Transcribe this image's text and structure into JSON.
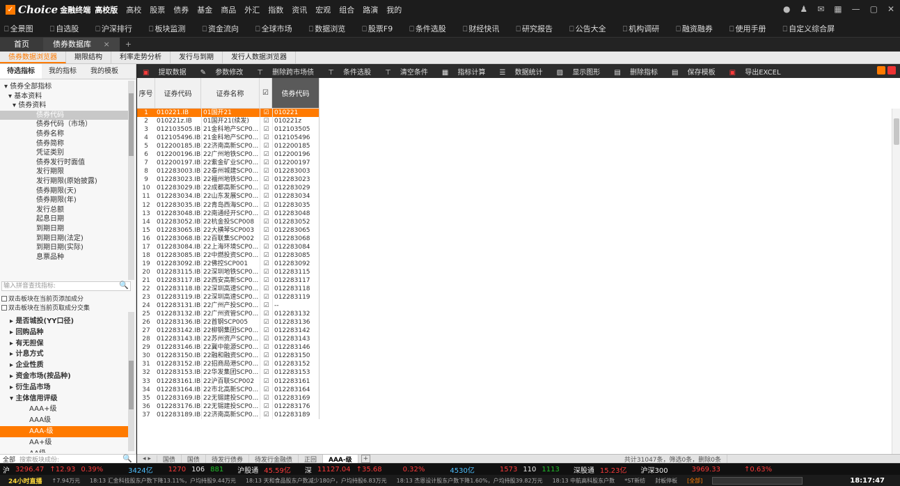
{
  "titlebar": {
    "brand": "Choice",
    "brand_sub": "金融终端",
    "edition": "高校版",
    "menu": [
      "高校",
      "股票",
      "债券",
      "基金",
      "商品",
      "外汇",
      "指数",
      "资讯",
      "宏观",
      "组合",
      "路演",
      "我的"
    ]
  },
  "toolbar": [
    "全景图",
    "自选股",
    "沪深排行",
    "板块监测",
    "资金流向",
    "全球市场",
    "数据浏览",
    "股票F9",
    "条件选股",
    "财经快讯",
    "研究报告",
    "公告大全",
    "机构调研",
    "融资融券",
    "使用手册",
    "自定义综合屏"
  ],
  "tabs": {
    "home": "首页",
    "current": "债券数据库",
    "add": "+"
  },
  "subtabs": [
    "债券数据浏览器",
    "期限结构",
    "利率走势分析",
    "发行与到期",
    "发行人数据浏览器"
  ],
  "left": {
    "tabs": [
      "待选指标",
      "我的指标",
      "我的模板"
    ],
    "tree": [
      "▾ 债券全部指标",
      "  ▾ 基本资料",
      "    ▾ 债券资料",
      "债券代码",
      "债券代码（市场）",
      "债券名称",
      "债券简称",
      "凭证类别",
      "债券发行时面值",
      "发行期限",
      "发行期限(原始披露)",
      "债券期限(天)",
      "债券期限(年)",
      "发行总额",
      "起息日期",
      "到期日期",
      "到期日期(法定)",
      "到期日期(实际)",
      "息票品种"
    ],
    "search_placeholder": "输入拼音查找指标:",
    "check1": "双击板块在当前页添加成分",
    "check2": "双击板块在当前页取成分交集",
    "tree2": [
      "▸ 是否城投(YY口径)",
      "▸ 回购品种",
      "▸ 有无担保",
      "▸ 计息方式",
      "▸ 企业性质",
      "▸ 资金市场(按品种)",
      "▸ 衍生品市场",
      "▾ 主体信用评级",
      "AAA+级",
      "AAA级",
      "AAA-级",
      "AA+级",
      "AA级"
    ],
    "bottom_label": "全部",
    "bottom_search": "搜索板块成份:"
  },
  "actions": [
    "提取数据",
    "参数修改",
    "删除跨市场债",
    "条件选股",
    "清空条件",
    "指标计算",
    "数据统计",
    "显示图形",
    "删除指标",
    "保存模板",
    "导出EXCEL"
  ],
  "grid": {
    "headers": [
      "序号",
      "证券代码",
      "证券名称",
      "☑",
      "债券代码"
    ],
    "rows": [
      [
        "1",
        "010221.IB",
        "01国开21",
        "☑",
        "010221"
      ],
      [
        "2",
        "010221z.IB",
        "01国开21(续发)",
        "☑",
        "010221z"
      ],
      [
        "3",
        "012103505.IB",
        "21金科地产SCP0...",
        "☑",
        "012103505"
      ],
      [
        "4",
        "012105496.IB",
        "21金科地产SCP0...",
        "☑",
        "012105496"
      ],
      [
        "5",
        "012200185.IB",
        "22济南高新SCP0...",
        "☑",
        "012200185"
      ],
      [
        "6",
        "012200196.IB",
        "22广州地铁SCP0...",
        "☑",
        "012200196"
      ],
      [
        "7",
        "012200197.IB",
        "22紫金矿业SCP0...",
        "☑",
        "012200197"
      ],
      [
        "8",
        "012283003.IB",
        "22泰州城建SCP0...",
        "☑",
        "012283003"
      ],
      [
        "9",
        "012283023.IB",
        "22福州地铁SCP0...",
        "☑",
        "012283023"
      ],
      [
        "10",
        "012283029.IB",
        "22成都高新SCP0...",
        "☑",
        "012283029"
      ],
      [
        "11",
        "012283034.IB",
        "22山东发展SCP0...",
        "☑",
        "012283034"
      ],
      [
        "12",
        "012283035.IB",
        "22青岛西海SCP0...",
        "☑",
        "012283035"
      ],
      [
        "13",
        "012283048.IB",
        "22南通经开SCP0...",
        "☑",
        "012283048"
      ],
      [
        "14",
        "012283052.IB",
        "22杭金投SCP008",
        "☑",
        "012283052"
      ],
      [
        "15",
        "012283065.IB",
        "22大横琴SCP003",
        "☑",
        "012283065"
      ],
      [
        "16",
        "012283068.IB",
        "22百联集SCP002",
        "☑",
        "012283068"
      ],
      [
        "17",
        "012283084.IB",
        "22上海环境SCP0...",
        "☑",
        "012283084"
      ],
      [
        "18",
        "012283085.IB",
        "22中燃投资SCP0...",
        "☑",
        "012283085"
      ],
      [
        "19",
        "012283092.IB",
        "22佛控SCP001",
        "☑",
        "012283092"
      ],
      [
        "20",
        "012283115.IB",
        "22深圳地铁SCP0...",
        "☑",
        "012283115"
      ],
      [
        "21",
        "012283117.IB",
        "22西安高新SCP0...",
        "☑",
        "012283117"
      ],
      [
        "22",
        "012283118.IB",
        "22深圳高速SCP0...",
        "☑",
        "012283118"
      ],
      [
        "23",
        "012283119.IB",
        "22深圳高速SCP0...",
        "☑",
        "012283119"
      ],
      [
        "24",
        "012283131.IB",
        "22广州产投SCP0...",
        "☑",
        "--"
      ],
      [
        "25",
        "012283132.IB",
        "22广州资管SCP0...",
        "☑",
        "012283132"
      ],
      [
        "26",
        "012283136.IB",
        "22首钢SCP005",
        "☑",
        "012283136"
      ],
      [
        "27",
        "012283142.IB",
        "22柳钢集团SCP0...",
        "☑",
        "012283142"
      ],
      [
        "28",
        "012283143.IB",
        "22苏州资产SCP0...",
        "☑",
        "012283143"
      ],
      [
        "29",
        "012283146.IB",
        "22冀中能源SCP0...",
        "☑",
        "012283146"
      ],
      [
        "30",
        "012283150.IB",
        "22融和融资SCP0...",
        "☑",
        "012283150"
      ],
      [
        "31",
        "012283152.IB",
        "22招商局港SCP0...",
        "☑",
        "012283152"
      ],
      [
        "32",
        "012283153.IB",
        "22华发集团SCP0...",
        "☑",
        "012283153"
      ],
      [
        "33",
        "012283161.IB",
        "22沪百联SCP002",
        "☑",
        "012283161"
      ],
      [
        "34",
        "012283164.IB",
        "22市北高新SCP0...",
        "☑",
        "012283164"
      ],
      [
        "35",
        "012283169.IB",
        "22无锡建投SCP0...",
        "☑",
        "012283169"
      ],
      [
        "36",
        "012283176.IB",
        "22无锡建投SCP0...",
        "☑",
        "012283176"
      ],
      [
        "37",
        "012283189.IB",
        "22济南高新SCP0...",
        "☑",
        "012283189"
      ]
    ]
  },
  "sheettabs": [
    "国债",
    "国债",
    "待发行债券",
    "待发行金融债",
    "正回",
    "AAA-级"
  ],
  "sheetinfo": "共计31047条，筛选0条，删除0条",
  "ticker": {
    "sh": "沪",
    "sh_val": "3296.47",
    "sh_chg": "↑12.93",
    "sh_pct": "0.39%",
    "sh_amt": "3424亿",
    "sh_up": "1270",
    "sh_flat": "106",
    "sh_down": "881",
    "hgt": "沪股通",
    "hgt_val": "45.59亿",
    "sz": "深",
    "sz_val": "11127.04",
    "sz_chg": "↑35.68",
    "sz_pct": "0.32%",
    "sz_amt": "4530亿",
    "sz_up": "1573",
    "sz_flat": "110",
    "sz_down": "1113",
    "sgt": "深股通",
    "sgt_val": "15.23亿",
    "hs300": "沪深300",
    "hs300_val": "3969.33",
    "hs300_pct": "↑0.63%"
  },
  "news": {
    "live": "24小时直播",
    "items": [
      "↑7.94万元",
      "18:13 汇金科技股东户数下降13.11%，户均持股9.44万元",
      "18:13 天和食品股东户数减少180户，户均持股6.83万元",
      "18:13 杰恩设计股东户数下降1.60%，户均持股39.82万元",
      "18:13 中航高科股东户数",
      "*ST新纺",
      "封板停板"
    ],
    "tag": "[全部]",
    "time": "18:17:47"
  }
}
